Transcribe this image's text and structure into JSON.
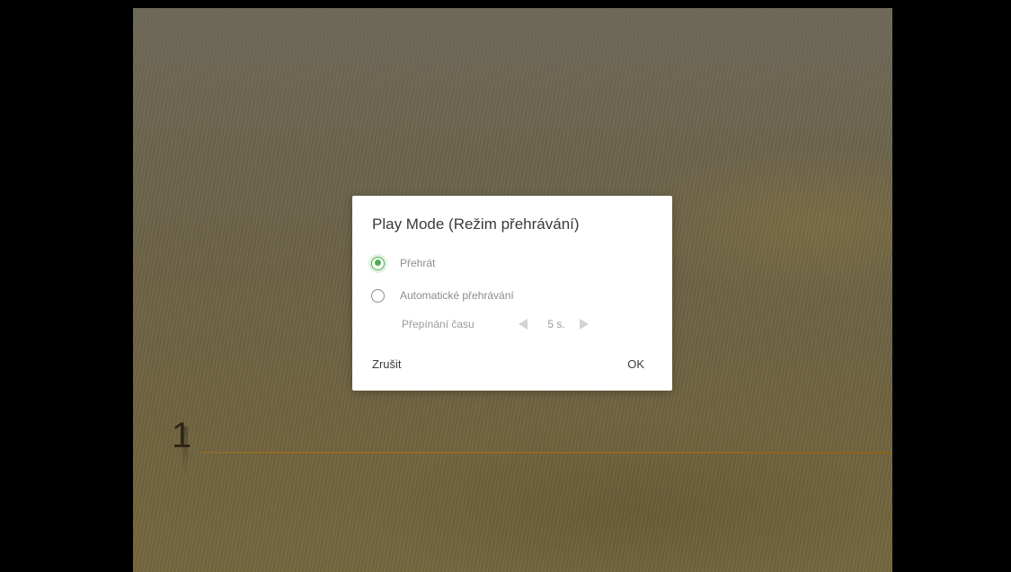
{
  "slide": {
    "number": "1"
  },
  "dialog": {
    "title": "Play Mode (Režim přehrávání)",
    "options": [
      {
        "label": "Přehrát",
        "checked": true
      },
      {
        "label": "Automatické přehrávání",
        "checked": false
      }
    ],
    "interval": {
      "label": "Přepínání času",
      "value": "5 s."
    },
    "cancel_label": "Zrušit",
    "ok_label": "OK"
  },
  "colors": {
    "accent": "#4caf50",
    "slide_rule": "#9a6a22",
    "slide_background": "#6d6449"
  }
}
